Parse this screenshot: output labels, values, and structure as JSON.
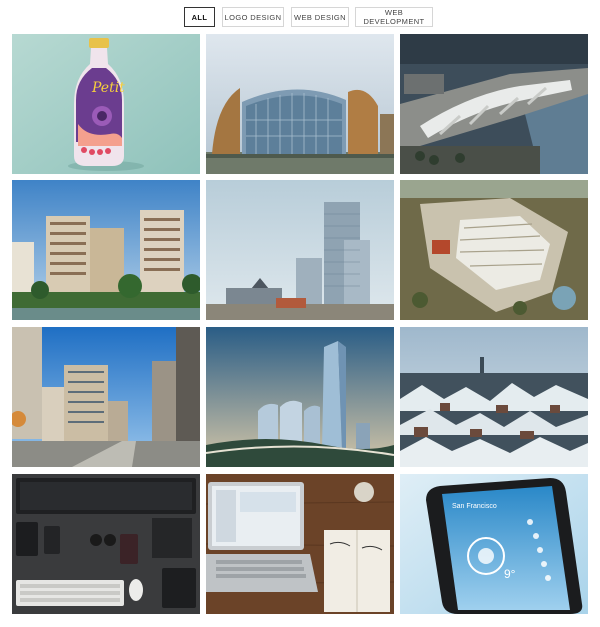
{
  "filters": [
    {
      "label": "ALL",
      "active": true
    },
    {
      "label": "LOGO DESIGN",
      "active": false
    },
    {
      "label": "WEB DESIGN",
      "active": false
    },
    {
      "label": "WEB DEVELOPMENT",
      "active": false
    }
  ],
  "portfolio": {
    "tiles": [
      {
        "subject": "juice-bottle",
        "bottle_text": "Petit"
      },
      {
        "subject": "glass-dome-building"
      },
      {
        "subject": "aerial-waterfront-mall"
      },
      {
        "subject": "residential-towers"
      },
      {
        "subject": "office-skyscraper"
      },
      {
        "subject": "aerial-campus"
      },
      {
        "subject": "street-buildings"
      },
      {
        "subject": "curved-glass-towers"
      },
      {
        "subject": "snowy-rooftops"
      },
      {
        "subject": "desk-workspace"
      },
      {
        "subject": "laptop-notebook"
      },
      {
        "subject": "weather-app-phone",
        "phone_city": "San Francisco",
        "phone_temp": "9°"
      }
    ]
  },
  "colors": {
    "active_border": "#333333",
    "border": "#d6d6d6",
    "background": "#ffffff"
  }
}
